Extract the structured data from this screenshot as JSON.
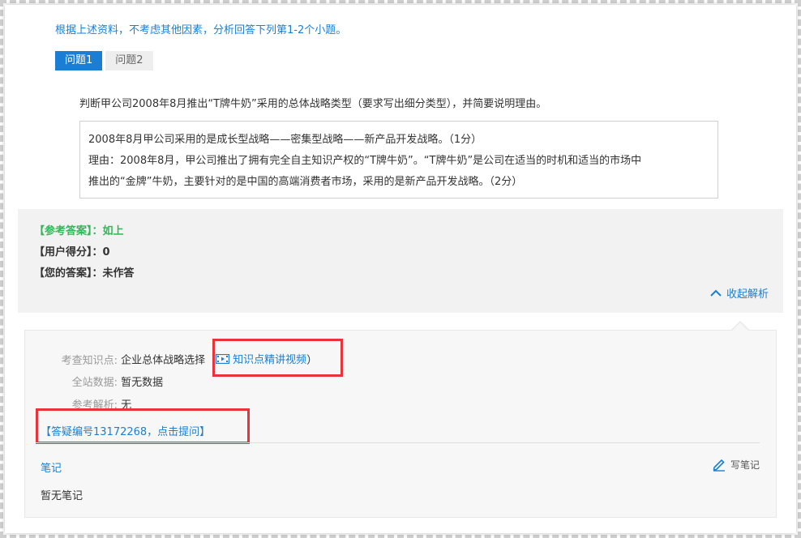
{
  "instruction": "根据上述资料，不考虑其他因素，分析回答下列第1-2个小题。",
  "tabs": [
    {
      "label": "问题1",
      "active": true
    },
    {
      "label": "问题2",
      "active": false
    }
  ],
  "question": "判断甲公司2008年8月推出“T牌牛奶”采用的总体战略类型（要求写出细分类型），并简要说明理由。",
  "answer_lines": [
    "2008年8月甲公司采用的是成长型战略——密集型战略——新产品开发战略。（1分）",
    "理由：2008年8月，甲公司推出了拥有完全自主知识产权的“T牌牛奶”。“T牌牛奶”是公司在适当的时机和适当的市场中",
    "推出的“金牌”牛奶，主要针对的是中国的高端消费者市场，采用的是新产品开发战略。（2分）"
  ],
  "reference": {
    "ref_answer": "【参考答案】：如上",
    "user_score": "【用户得分】：0",
    "your_answer": "【您的答案】：未作答",
    "collapse_label": "收起解析"
  },
  "details": {
    "knowledge_key": "考查知识点:",
    "knowledge_value": "企业总体战略选择",
    "paren_open": "（",
    "video_link": "知识点精讲视频",
    "paren_close": "）",
    "site_data_key": "全站数据:",
    "site_data_value": "暂无数据",
    "analysis_key": "参考解析:",
    "analysis_value": "无",
    "ask_link": "【答疑编号13172268，点击提问】"
  },
  "notes": {
    "title": "笔记",
    "write_label": "写笔记",
    "empty": "暂无笔记"
  },
  "colors": {
    "accent": "#1a7fd4",
    "green": "#35b559",
    "highlight_red": "#e8333a"
  }
}
